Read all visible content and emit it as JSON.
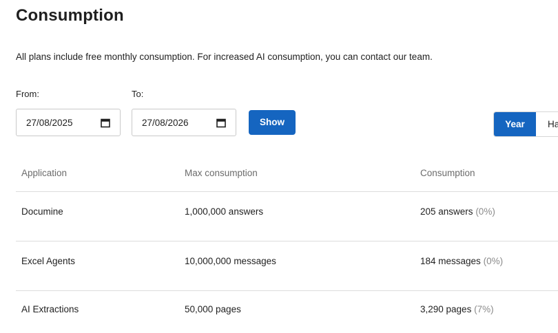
{
  "header": {
    "title": "Consumption",
    "description": "All plans include free monthly consumption. For increased AI consumption, you can contact our team."
  },
  "filters": {
    "from_label": "From:",
    "from_value": "27/08/2025",
    "to_label": "To:",
    "to_value": "27/08/2026",
    "show_label": "Show"
  },
  "period_toggle": {
    "options": [
      "Year",
      "Ha"
    ],
    "selected": "Year",
    "accent_color": "#1565c0"
  },
  "table": {
    "columns": [
      "Application",
      "Max consumption",
      "Consumption"
    ],
    "rows": [
      {
        "application": "Documine",
        "max": "1,000,000 answers",
        "consumption": "205 answers",
        "percent": "(0%)"
      },
      {
        "application": "Excel Agents",
        "max": "10,000,000 messages",
        "consumption": "184 messages",
        "percent": "(0%)"
      },
      {
        "application": "AI Extractions",
        "max": "50,000 pages",
        "consumption": "3,290 pages",
        "percent": "(7%)"
      }
    ]
  },
  "icons": {
    "date_picker": "calendar-icon"
  }
}
